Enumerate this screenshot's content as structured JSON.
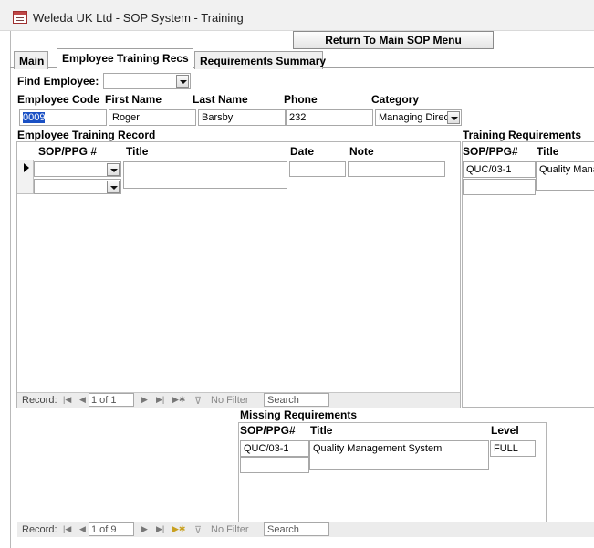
{
  "window": {
    "title": "Weleda UK Ltd - SOP System - Training",
    "icon": "form-window-icon"
  },
  "header": {
    "return_button": "Return To Main SOP Menu"
  },
  "tabs": [
    {
      "label": "Main",
      "active": false
    },
    {
      "label": "Employee Training Recs",
      "active": true
    },
    {
      "label": "Requirements Summary",
      "active": false
    }
  ],
  "find": {
    "label": "Find Employee:",
    "value": ""
  },
  "employee": {
    "headers": {
      "code": "Employee Code",
      "first": "First Name",
      "last": "Last Name",
      "phone": "Phone",
      "category": "Category"
    },
    "code": "0009",
    "first_name": "Roger",
    "last_name": "Barsby",
    "phone": "232",
    "category": "Managing Direc"
  },
  "training_record": {
    "title": "Employee Training Record",
    "columns": {
      "sop": "SOP/PPG #",
      "title": "Title",
      "date": "Date",
      "note": "Note"
    },
    "nav": {
      "record_label": "Record:",
      "position": "1 of 1",
      "filter": "No Filter",
      "search": "Search"
    }
  },
  "training_requirements": {
    "title": "Training Requirements",
    "columns": {
      "sop": "SOP/PPG#",
      "title": "Title"
    },
    "rows": [
      {
        "sop": "QUC/03-1",
        "title": "Quality Mana"
      }
    ]
  },
  "missing_requirements": {
    "title": "Missing Requirements",
    "columns": {
      "sop": "SOP/PPG#",
      "title": "Title",
      "level": "Level"
    },
    "rows": [
      {
        "sop": "QUC/03-1",
        "title": "Quality Management System",
        "level": "FULL"
      }
    ]
  },
  "main_nav": {
    "record_label": "Record:",
    "position": "1 of 9",
    "filter": "No Filter",
    "search": "Search"
  },
  "colors": {
    "selection": "#1a50c4",
    "title_bar": "#f1f1f1"
  }
}
